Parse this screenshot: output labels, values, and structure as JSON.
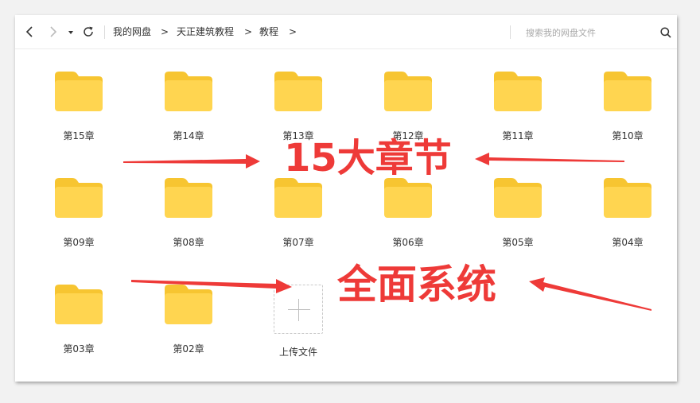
{
  "toolbar": {
    "back_icon": "chevron-left-icon",
    "forward_icon": "chevron-right-icon",
    "dropdown_icon": "caret-down-icon",
    "refresh_icon": "refresh-icon",
    "breadcrumbs": [
      "我的网盘",
      "天正建筑教程",
      "教程"
    ],
    "separator": ">",
    "search_placeholder": "搜索我的网盘文件",
    "search_icon": "search-icon"
  },
  "folders": [
    {
      "name": "第15章"
    },
    {
      "name": "第14章"
    },
    {
      "name": "第13章"
    },
    {
      "name": "第12章"
    },
    {
      "name": "第11章"
    },
    {
      "name": "第10章"
    },
    {
      "name": "第09章"
    },
    {
      "name": "第08章"
    },
    {
      "name": "第07章"
    },
    {
      "name": "第06章"
    },
    {
      "name": "第05章"
    },
    {
      "name": "第04章"
    },
    {
      "name": "第03章"
    },
    {
      "name": "第02章"
    }
  ],
  "upload": {
    "label": "上传文件",
    "icon": "plus-icon"
  },
  "annotations": {
    "line1": "15大章节",
    "line2": "全面系统",
    "color": "#ee3a38"
  },
  "colors": {
    "folder_body": "#ffd550",
    "folder_tab": "#f7c531"
  }
}
